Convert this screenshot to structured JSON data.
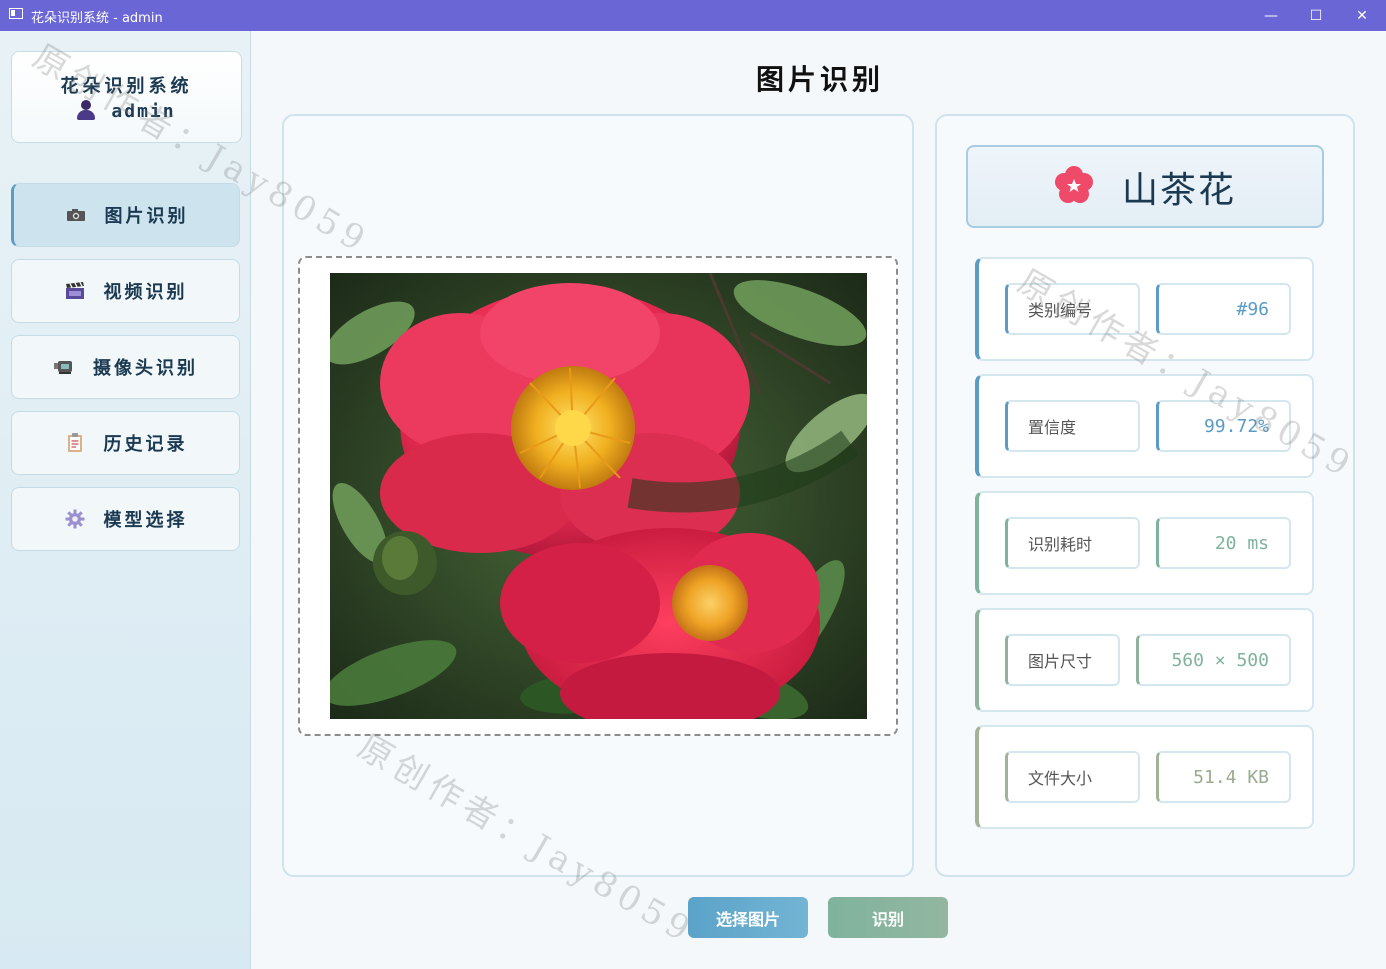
{
  "window": {
    "title": "花朵识别系统 - admin",
    "controls": {
      "minimize": "—",
      "maximize": "☐",
      "close": "✕"
    }
  },
  "sidebar": {
    "system_name": "花朵识别系统",
    "username": "admin",
    "items": [
      {
        "label": "图片识别",
        "icon": "camera-icon",
        "active": true
      },
      {
        "label": "视频识别",
        "icon": "clapperboard-icon",
        "active": false
      },
      {
        "label": "摄像头识别",
        "icon": "webcam-icon",
        "active": false
      },
      {
        "label": "历史记录",
        "icon": "clipboard-icon",
        "active": false
      },
      {
        "label": "模型选择",
        "icon": "gear-icon",
        "active": false
      }
    ]
  },
  "main": {
    "title": "图片识别",
    "result_name": "山茶花",
    "result_icon": "flower-icon",
    "stats": [
      {
        "label": "类别编号",
        "value": "#96"
      },
      {
        "label": "置信度",
        "value": "99.72%"
      },
      {
        "label": "识别耗时",
        "value": "20 ms"
      },
      {
        "label": "图片尺寸",
        "value": "560 × 500"
      },
      {
        "label": "文件大小",
        "value": "51.4 KB"
      }
    ],
    "buttons": {
      "select": "选择图片",
      "recognize": "识别"
    }
  },
  "watermark": "原创作者：Jay8059",
  "colors": {
    "titlebar": "#6a66d6",
    "accent": "#5a9cc4",
    "select_button": "#5aa3c8",
    "recognize_button": "#7fb39d"
  }
}
